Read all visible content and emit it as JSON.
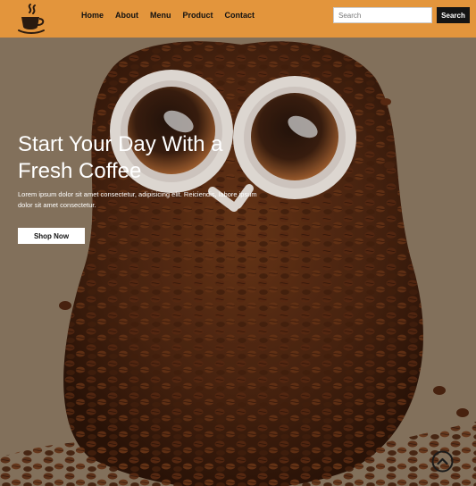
{
  "nav": {
    "links": [
      {
        "label": "Home"
      },
      {
        "label": "About"
      },
      {
        "label": "Menu"
      },
      {
        "label": "Product"
      },
      {
        "label": "Contact"
      }
    ],
    "search_placeholder": "Search",
    "search_button": "Search"
  },
  "hero": {
    "title": "Start Your Day With a Fresh Coffee",
    "subtitle": "Lorem ipsum dolor sit amet consectetur, adipisicing elit. Reiciendis, labore ipsum dolor sit amet consectetur.",
    "cta": "Shop Now"
  },
  "icons": {
    "logo": "coffee-cup-logo-icon",
    "scroll_top": "chevron-up-circle-icon"
  },
  "colors": {
    "navbar": "#e3953c",
    "search_button": "#141414",
    "text_light": "#ffffff"
  }
}
